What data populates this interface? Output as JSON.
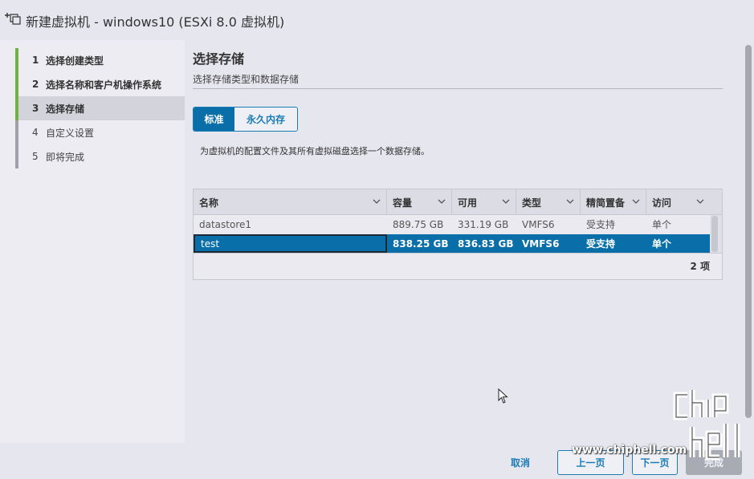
{
  "window": {
    "title": "新建虚拟机 - windows10 (ESXi 8.0 虚拟机)",
    "icon": "new-vm-icon"
  },
  "sidebar": {
    "steps": [
      {
        "num": "1",
        "label": "选择创建类型",
        "state": "done"
      },
      {
        "num": "2",
        "label": "选择名称和客户机操作系统",
        "state": "done"
      },
      {
        "num": "3",
        "label": "选择存储",
        "state": "active"
      },
      {
        "num": "4",
        "label": "自定义设置",
        "state": "pending"
      },
      {
        "num": "5",
        "label": "即将完成",
        "state": "pending"
      }
    ]
  },
  "main": {
    "title": "选择存储",
    "subtitle": "选择存储类型和数据存储",
    "segments": [
      {
        "label": "标准",
        "selected": true
      },
      {
        "label": "永久内存",
        "selected": false
      }
    ],
    "description": "为虚拟机的配置文件及其所有虚拟磁盘选择一个数据存储。",
    "table": {
      "columns": [
        "名称",
        "容量",
        "可用",
        "类型",
        "精简置备",
        "访问"
      ],
      "rows": [
        {
          "cells": [
            "datastore1",
            "889.75 GB",
            "331.19 GB",
            "VMFS6",
            "受支持",
            "单个"
          ],
          "selected": false
        },
        {
          "cells": [
            "test",
            "838.25 GB",
            "836.83 GB",
            "VMFS6",
            "受支持",
            "单个"
          ],
          "selected": true
        }
      ],
      "count": "2 项"
    }
  },
  "footer": {
    "cancel": "取消",
    "prev": "上一页",
    "next": "下一页",
    "finish": "完成"
  },
  "watermark": {
    "url": "www.chiphell.com",
    "logo_text": "chip hell"
  },
  "colors": {
    "accent": "#0a6fa8",
    "progress": "#6db33f",
    "background": "#e6e6ee"
  }
}
